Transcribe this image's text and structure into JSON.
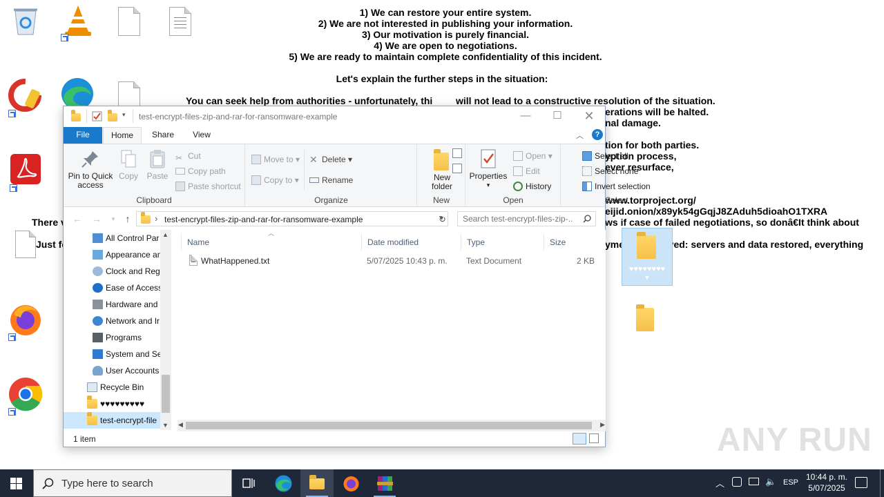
{
  "ransom_note": {
    "lines": [
      "1) We can restore your entire system.",
      "2) We are not interested in publishing your information.",
      "3) Our motivation is purely financial.",
      "4) We are open to negotiations.",
      "5) We are ready to maintain complete confidentiality of this incident.",
      "Let's explain the further steps in the situation:",
      "You can seek help from authorities - unfortunately, thi",
      "will not lead to a constructive resolution of the situation.",
      "erations will be halted.",
      "nal damage.",
      "tion for both parties.",
      "yption process,",
      "ever resurface,",
      "www.torproject.org/",
      "eijid.onion/x89yk54gGqjJ8ZAduh5dioahO1TXRA",
      "ws if case of failed negotiations, so donâ€It think about",
      "yment",
      "sived: servers and data restored, everything",
      "There v",
      "Just fo"
    ]
  },
  "desktop": {
    "folder_label": "♥♥♥♥♥♥♥♥"
  },
  "explorer": {
    "title": "test-encrypt-files-zip-and-rar-for-ransomware-example",
    "tabs": [
      "File",
      "Home",
      "Share",
      "View"
    ],
    "ribbon": {
      "clipboard": {
        "label": "Clipboard",
        "pin": "Pin to Quick\naccess",
        "pin_l1": "Pin to Quick",
        "pin_l2": "access",
        "copy": "Copy",
        "paste": "Paste",
        "cut": "Cut",
        "copy_path": "Copy path",
        "paste_shortcut": "Paste shortcut"
      },
      "organize": {
        "label": "Organize",
        "move_to": "Move to",
        "copy_to": "Copy to",
        "delete": "Delete",
        "rename": "Rename"
      },
      "new": {
        "label": "New",
        "new_folder_l1": "New",
        "new_folder_l2": "folder"
      },
      "open": {
        "label": "Open",
        "properties": "Properties",
        "open": "Open",
        "edit": "Edit",
        "history": "History"
      },
      "select": {
        "label": "Select",
        "select_all": "Select all",
        "select_none": "Select none",
        "invert": "Invert selection"
      }
    },
    "address": {
      "path": "test-encrypt-files-zip-and-rar-for-ransomware-example",
      "search_placeholder": "Search test-encrypt-files-zip-..."
    },
    "nav_items": [
      "All Control Par",
      "Appearance an",
      "Clock and Regi",
      "Ease of Access",
      "Hardware and",
      "Network and Ir",
      "Programs",
      "System and Sec",
      "User Accounts",
      "Recycle Bin",
      "♥♥♥♥♥♥♥♥♥",
      "test-encrypt-file"
    ],
    "columns": [
      "Name",
      "Date modified",
      "Type",
      "Size"
    ],
    "files": [
      {
        "name": "WhatHappened.txt",
        "date": "5/07/2025 10:43 p. m.",
        "type": "Text Document",
        "size": "2 KB"
      }
    ],
    "status": "1 item"
  },
  "taskbar": {
    "search_placeholder": "Type here to search",
    "language": "ESP",
    "time": "10:44 p. m.",
    "date": "5/07/2025"
  },
  "watermark": "ANY RUN",
  "colors": {
    "accent": "#1979ca",
    "taskbar": "#1f2838",
    "selection": "#cce8ff",
    "folder": "#f5c04a"
  }
}
